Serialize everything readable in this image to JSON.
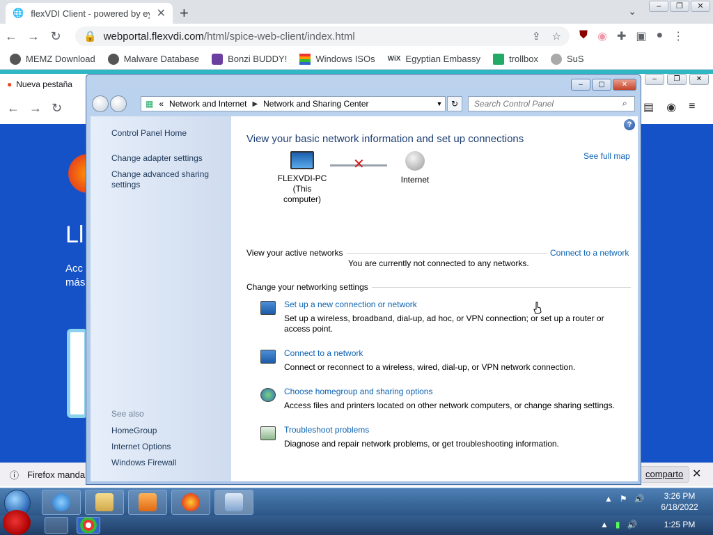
{
  "chrome": {
    "tab_title": "flexVDI Client - powered by ey",
    "url_host": "webportal.flexvdi.com",
    "url_path": "/html/spice-web-client/index.html",
    "bookmarks": [
      {
        "label": "MEMZ Download",
        "icon": "globe-icon"
      },
      {
        "label": "Malware Database",
        "icon": "globe-icon"
      },
      {
        "label": "Bonzi BUDDY!",
        "icon": "bonzi-icon"
      },
      {
        "label": "Windows ISOs",
        "icon": "windows-flag-icon"
      },
      {
        "label": "Egyptian Embassy",
        "icon": "wix-icon"
      },
      {
        "label": "trollbox",
        "icon": "trollbox-icon"
      },
      {
        "label": "SuS",
        "icon": "sus-icon"
      }
    ]
  },
  "firefox": {
    "tab_title": "Nueva pestaña",
    "hero_text": "Ll",
    "sub_text": "Acc más",
    "notification": "Firefox manda a",
    "notification_button": "comparto"
  },
  "control_panel": {
    "breadcrumb_lead": "«",
    "breadcrumb_1": "Network and Internet",
    "breadcrumb_2": "Network and Sharing Center",
    "search_placeholder": "Search Control Panel",
    "left_links": [
      "Control Panel Home",
      "Change adapter settings",
      "Change advanced sharing settings"
    ],
    "see_also_title": "See also",
    "see_also_links": [
      "HomeGroup",
      "Internet Options",
      "Windows Firewall"
    ],
    "title": "View your basic network information and set up connections",
    "see_full_map": "See full map",
    "computer_name": "FLEXVDI-PC",
    "computer_sub": "(This computer)",
    "internet_label": "Internet",
    "active_networks": "View your active networks",
    "connect_link": "Connect to a network",
    "not_connected": "You are currently not connected to any networks.",
    "change_settings": "Change your networking settings",
    "tasks": [
      {
        "link": "Set up a new connection or network",
        "desc": "Set up a wireless, broadband, dial-up, ad hoc, or VPN connection; or set up a router or access point."
      },
      {
        "link": "Connect to a network",
        "desc": "Connect or reconnect to a wireless, wired, dial-up, or VPN network connection."
      },
      {
        "link": "Choose homegroup and sharing options",
        "desc": "Access files and printers located on other network computers, or change sharing settings."
      },
      {
        "link": "Troubleshoot problems",
        "desc": "Diagnose and repair network problems, or get troubleshooting information."
      }
    ]
  },
  "taskbar": {
    "inner_time": "3:26 PM",
    "inner_date": "6/18/2022",
    "outer_time": "1:25 PM"
  },
  "colors": {
    "link": "#0c62b3",
    "accent_teal": "#2fb7c4",
    "firefox_blue": "#1552c8"
  }
}
